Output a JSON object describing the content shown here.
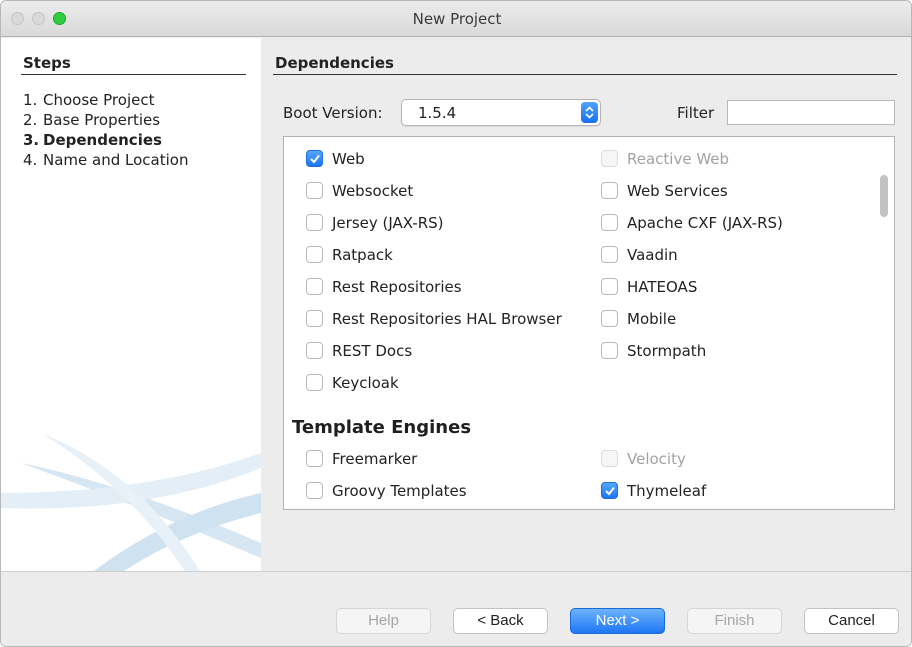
{
  "window": {
    "title": "New Project"
  },
  "steps": {
    "title": "Steps",
    "items": [
      {
        "num": "1.",
        "label": "Choose Project",
        "active": false
      },
      {
        "num": "2.",
        "label": "Base Properties",
        "active": false
      },
      {
        "num": "3.",
        "label": "Dependencies",
        "active": true
      },
      {
        "num": "4.",
        "label": "Name and Location",
        "active": false
      }
    ]
  },
  "content": {
    "title": "Dependencies",
    "boot_version_label": "Boot Version:",
    "boot_version_value": "1.5.4",
    "filter_label": "Filter",
    "filter_value": ""
  },
  "dependencies": {
    "web": [
      {
        "label": "Web",
        "checked": true,
        "enabled": true
      },
      {
        "label": "Reactive Web",
        "checked": false,
        "enabled": false
      },
      {
        "label": "Websocket",
        "checked": false,
        "enabled": true
      },
      {
        "label": "Web Services",
        "checked": false,
        "enabled": true
      },
      {
        "label": "Jersey (JAX-RS)",
        "checked": false,
        "enabled": true
      },
      {
        "label": "Apache CXF (JAX-RS)",
        "checked": false,
        "enabled": true
      },
      {
        "label": "Ratpack",
        "checked": false,
        "enabled": true
      },
      {
        "label": "Vaadin",
        "checked": false,
        "enabled": true
      },
      {
        "label": "Rest Repositories",
        "checked": false,
        "enabled": true
      },
      {
        "label": "HATEOAS",
        "checked": false,
        "enabled": true
      },
      {
        "label": "Rest Repositories HAL Browser",
        "checked": false,
        "enabled": true
      },
      {
        "label": "Mobile",
        "checked": false,
        "enabled": true
      },
      {
        "label": "REST Docs",
        "checked": false,
        "enabled": true
      },
      {
        "label": "Stormpath",
        "checked": false,
        "enabled": true
      },
      {
        "label": "Keycloak",
        "checked": false,
        "enabled": true
      }
    ],
    "template_engines_title": "Template Engines",
    "template_engines": [
      {
        "label": "Freemarker",
        "checked": false,
        "enabled": true
      },
      {
        "label": "Velocity",
        "checked": false,
        "enabled": false
      },
      {
        "label": "Groovy Templates",
        "checked": false,
        "enabled": true
      },
      {
        "label": "Thymeleaf",
        "checked": true,
        "enabled": true
      }
    ]
  },
  "buttons": {
    "help": "Help",
    "back": "< Back",
    "next": "Next >",
    "finish": "Finish",
    "cancel": "Cancel"
  },
  "colors": {
    "accent": "#1e76f2",
    "maximize": "#2fcc3f"
  }
}
